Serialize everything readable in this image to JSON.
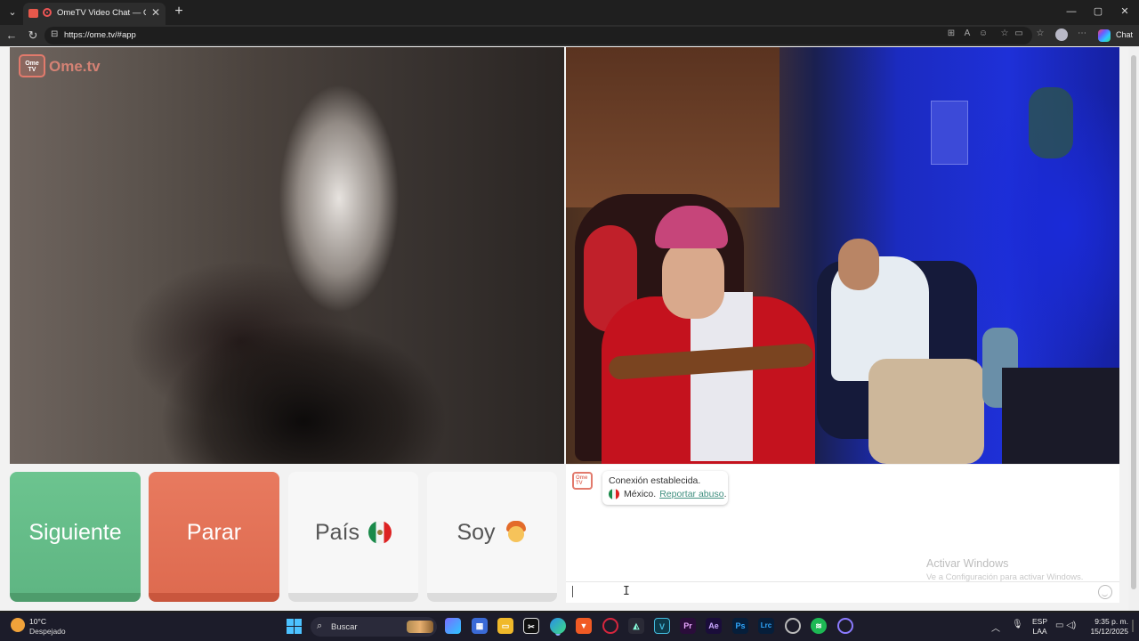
{
  "browser": {
    "tab_title": "OmeTV Video Chat — Omegle",
    "tab_close": "✕",
    "new_tab": "+",
    "url": "https://ome.tv/#app",
    "copilot_label": "Chat",
    "window_controls": [
      "—",
      "▢",
      "✕"
    ]
  },
  "site": {
    "logo_text": "Ome.tv",
    "logo_badge": "Ome TV"
  },
  "buttons": {
    "next": "Siguiente",
    "stop": "Parar",
    "country": "País",
    "country_flag": "mexico-flag",
    "gender": "Soy",
    "gender_icon": "boy-emoji"
  },
  "chat": {
    "status": "Conexión establecida.",
    "country": "México.",
    "report_link": "Reportar abuso",
    "report_suffix": ".",
    "watermark_title": "Activar Windows",
    "watermark_sub": "Ve a Configuración para activar Windows."
  },
  "taskbar": {
    "temperature": "10°C",
    "condition": "Despejado",
    "search_label": "Buscar",
    "apps": [
      "Pr",
      "Ae",
      "Ps",
      "Lrc"
    ],
    "lang_line1": "ESP",
    "lang_line2": "LAA",
    "time": "9:35 p. m.",
    "date": "15/12/2025"
  },
  "colors": {
    "next_green": "#6cc48f",
    "stop_orange": "#e87a5f",
    "link_teal": "#3f8f7f",
    "brand_logo": "#e27a6c"
  }
}
